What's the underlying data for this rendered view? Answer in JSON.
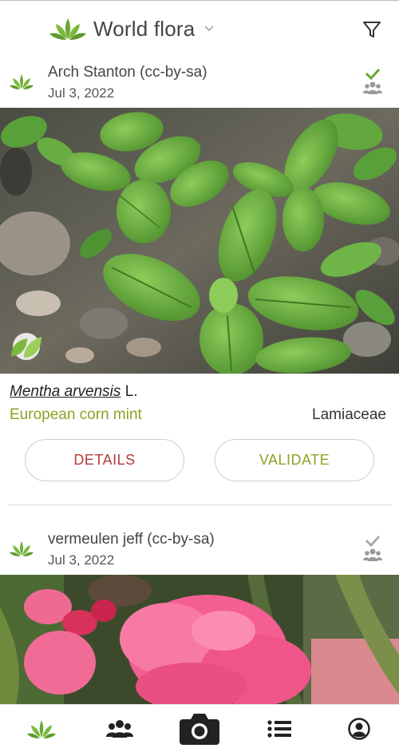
{
  "header": {
    "title": "World flora"
  },
  "observations": [
    {
      "author": "Arch Stanton (cc-by-sa)",
      "date": "Jul 3, 2022",
      "species_scientific": "Mentha arvensis",
      "species_authority": "L.",
      "common_name": "European corn mint",
      "family": "Lamiaceae",
      "details_label": "DETAILS",
      "validate_label": "VALIDATE",
      "status_icon": "check-validated-icon"
    },
    {
      "author": "vermeulen jeff (cc-by-sa)",
      "date": "Jul 3, 2022",
      "status_icon": "check-pending-icon"
    }
  ],
  "nav": [
    "sprout-icon",
    "community-icon",
    "camera-icon",
    "list-icon",
    "profile-icon"
  ],
  "colors": {
    "accent_green": "#8aa326",
    "details_red": "#b53a3a",
    "icon_gray": "#8a8a8a"
  }
}
